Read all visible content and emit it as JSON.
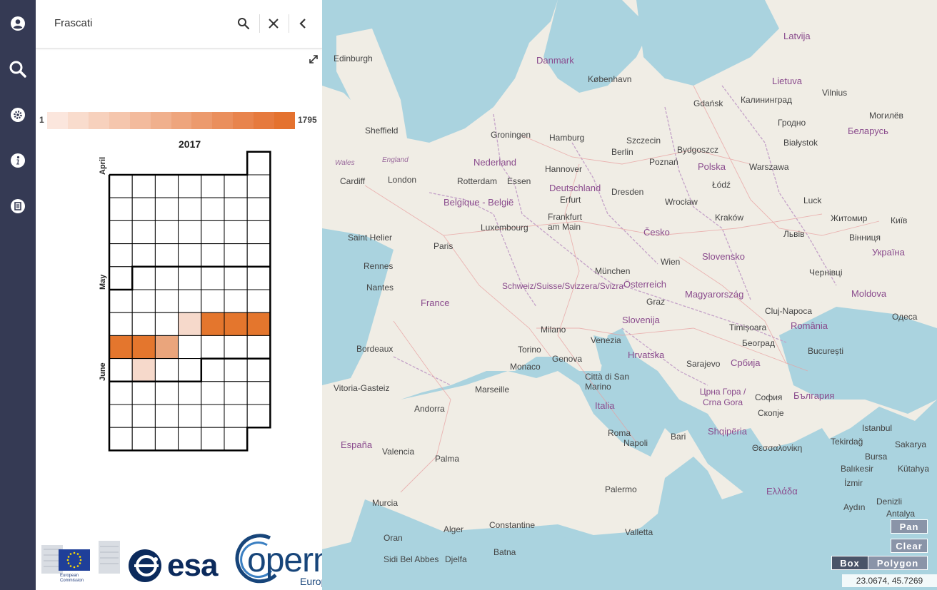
{
  "rail": {
    "icons": [
      "user-icon",
      "search-icon",
      "settings-icon",
      "info-icon",
      "document-icon"
    ]
  },
  "search": {
    "value": "Frascati"
  },
  "legend": {
    "min": "1",
    "max": "1795",
    "colors": [
      "#fbe6dd",
      "#f9dccd",
      "#f7d1bd",
      "#f5c6ad",
      "#f3bb9d",
      "#f0b08d",
      "#eea57d",
      "#ec9a6d",
      "#ea8f5d",
      "#e8844d",
      "#e67a3e",
      "#e4722f"
    ]
  },
  "calendar": {
    "year": "2017",
    "months": [
      "April",
      "May",
      "June"
    ],
    "highlight_colors": {
      "high": "#e4762d",
      "medium": "#eaa57c",
      "low": "#f6d9cb"
    }
  },
  "logos": {
    "ec_line1": "European",
    "ec_line2": "Commission",
    "esa": "esa",
    "copernicus": "opernicus",
    "copernicus_tagline": "Europe's eyes on Earth"
  },
  "map": {
    "controls": {
      "pan": "Pan",
      "clear": "Clear",
      "box": "Box",
      "polygon": "Polygon"
    },
    "coordinates": "23.0674, 45.7269",
    "countries": [
      "Danmark",
      "Latvija",
      "Lietuva",
      "Nederland",
      "Deutschland",
      "Polska",
      "Беларусь",
      "Belgique - België",
      "France",
      "Schweiz/Suisse/Svizzera/Svizra",
      "Österreich",
      "Česko",
      "Slovensko",
      "Magyarország",
      "România",
      "Moldova",
      "Україна",
      "Slovenija",
      "Hrvatska",
      "Србија",
      "Italia",
      "España",
      "Црна Гора / Crna Gora",
      "Shqipëria",
      "България",
      "Ελλάδα",
      "Luxembourg",
      "Monaco",
      "Andorra"
    ],
    "cities": [
      "Edinburgh",
      "Sheffield",
      "Cardiff",
      "London",
      "København",
      "Hamburg",
      "Groningen",
      "Szczecin",
      "Gdańsk",
      "Калининград",
      "Vilnius",
      "Гродно",
      "Могилёв",
      "Rotterdam",
      "Essen",
      "Hannover",
      "Berlin",
      "Poznań",
      "Bydgoszcz",
      "Warszawa",
      "Białystok",
      "Paris",
      "Rennes",
      "Nantes",
      "Saint Helier",
      "Frankfurt am Main",
      "Erfurt",
      "Dresden",
      "Wrocław",
      "Łódź",
      "Kraków",
      "Luck",
      "Житомир",
      "Київ",
      "München",
      "Wien",
      "Graz",
      "Львів",
      "Вінниця",
      "Чернівці",
      "Bordeaux",
      "Milano",
      "Torino",
      "Genova",
      "Venezia",
      "Timișoara",
      "Cluj-Napoca",
      "Одеса",
      "Београд",
      "București",
      "Sarajevo",
      "Marseille",
      "Vitoria-Gasteiz",
      "Città di San Marino",
      "София",
      "Скопје",
      "Napoli",
      "Bari",
      "Roma",
      "Palma",
      "Valencia",
      "Murcia",
      "Palermo",
      "Valletta",
      "Istanbul",
      "Tekirdağ",
      "Sakarya",
      "Bursa",
      "Kütahya",
      "Balıkesir",
      "Θεσσαλονίκη",
      "İzmir",
      "Aydın",
      "Denizli",
      "Antalya",
      "Oran",
      "Alger",
      "Constantine",
      "Batna",
      "Djelfa",
      "Sidi Bel Abbes",
      "Wales",
      "England"
    ]
  }
}
